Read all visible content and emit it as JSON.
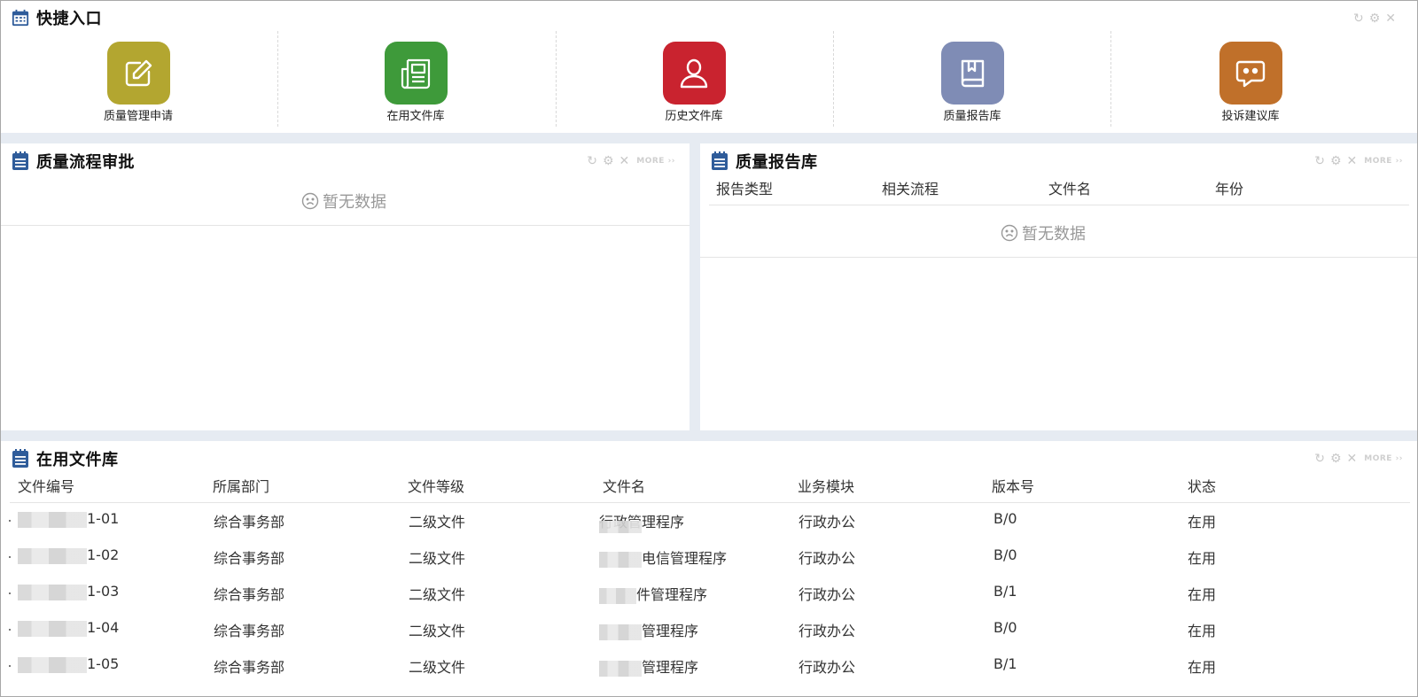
{
  "quick_entry": {
    "title": "快捷入口",
    "items": [
      {
        "label": "质量管理申请",
        "icon": "edit-icon",
        "color": "#b3a630"
      },
      {
        "label": "在用文件库",
        "icon": "document-icon",
        "color": "#3e9a3a"
      },
      {
        "label": "历史文件库",
        "icon": "user-icon",
        "color": "#c9232f"
      },
      {
        "label": "质量报告库",
        "icon": "book-icon",
        "color": "#7f8cb5"
      },
      {
        "label": "投诉建议库",
        "icon": "chat-icon",
        "color": "#c0702a"
      }
    ]
  },
  "process_approval": {
    "title": "质量流程审批",
    "empty_text": "暂无数据",
    "more": "MORE"
  },
  "quality_reports": {
    "title": "质量报告库",
    "columns": [
      "报告类型",
      "相关流程",
      "文件名",
      "年份"
    ],
    "empty_text": "暂无数据",
    "more": "MORE"
  },
  "active_files": {
    "title": "在用文件库",
    "more": "MORE",
    "columns": [
      "文件编号",
      "所属部门",
      "文件等级",
      "文件名",
      "业务模块",
      "版本号",
      "状态"
    ],
    "rows": [
      {
        "code": "1-01",
        "dept": "综合事务部",
        "level": "二级文件",
        "name": "行政管理程序",
        "module": "行政办公",
        "version": "B/0",
        "status": "在用"
      },
      {
        "code": "1-02",
        "dept": "综合事务部",
        "level": "二级文件",
        "name": "电信管理程序",
        "module": "行政办公",
        "version": "B/0",
        "status": "在用"
      },
      {
        "code": "1-03",
        "dept": "综合事务部",
        "level": "二级文件",
        "name": "件管理程序",
        "module": "行政办公",
        "version": "B/1",
        "status": "在用"
      },
      {
        "code": "1-04",
        "dept": "综合事务部",
        "level": "二级文件",
        "name": "管理程序",
        "module": "行政办公",
        "version": "B/0",
        "status": "在用"
      },
      {
        "code": "1-05",
        "dept": "综合事务部",
        "level": "二级文件",
        "name": "管理程序",
        "module": "行政办公",
        "version": "B/1",
        "status": "在用"
      }
    ]
  },
  "colors": {
    "accent": "#2f5c9a",
    "empty": "#999999"
  }
}
